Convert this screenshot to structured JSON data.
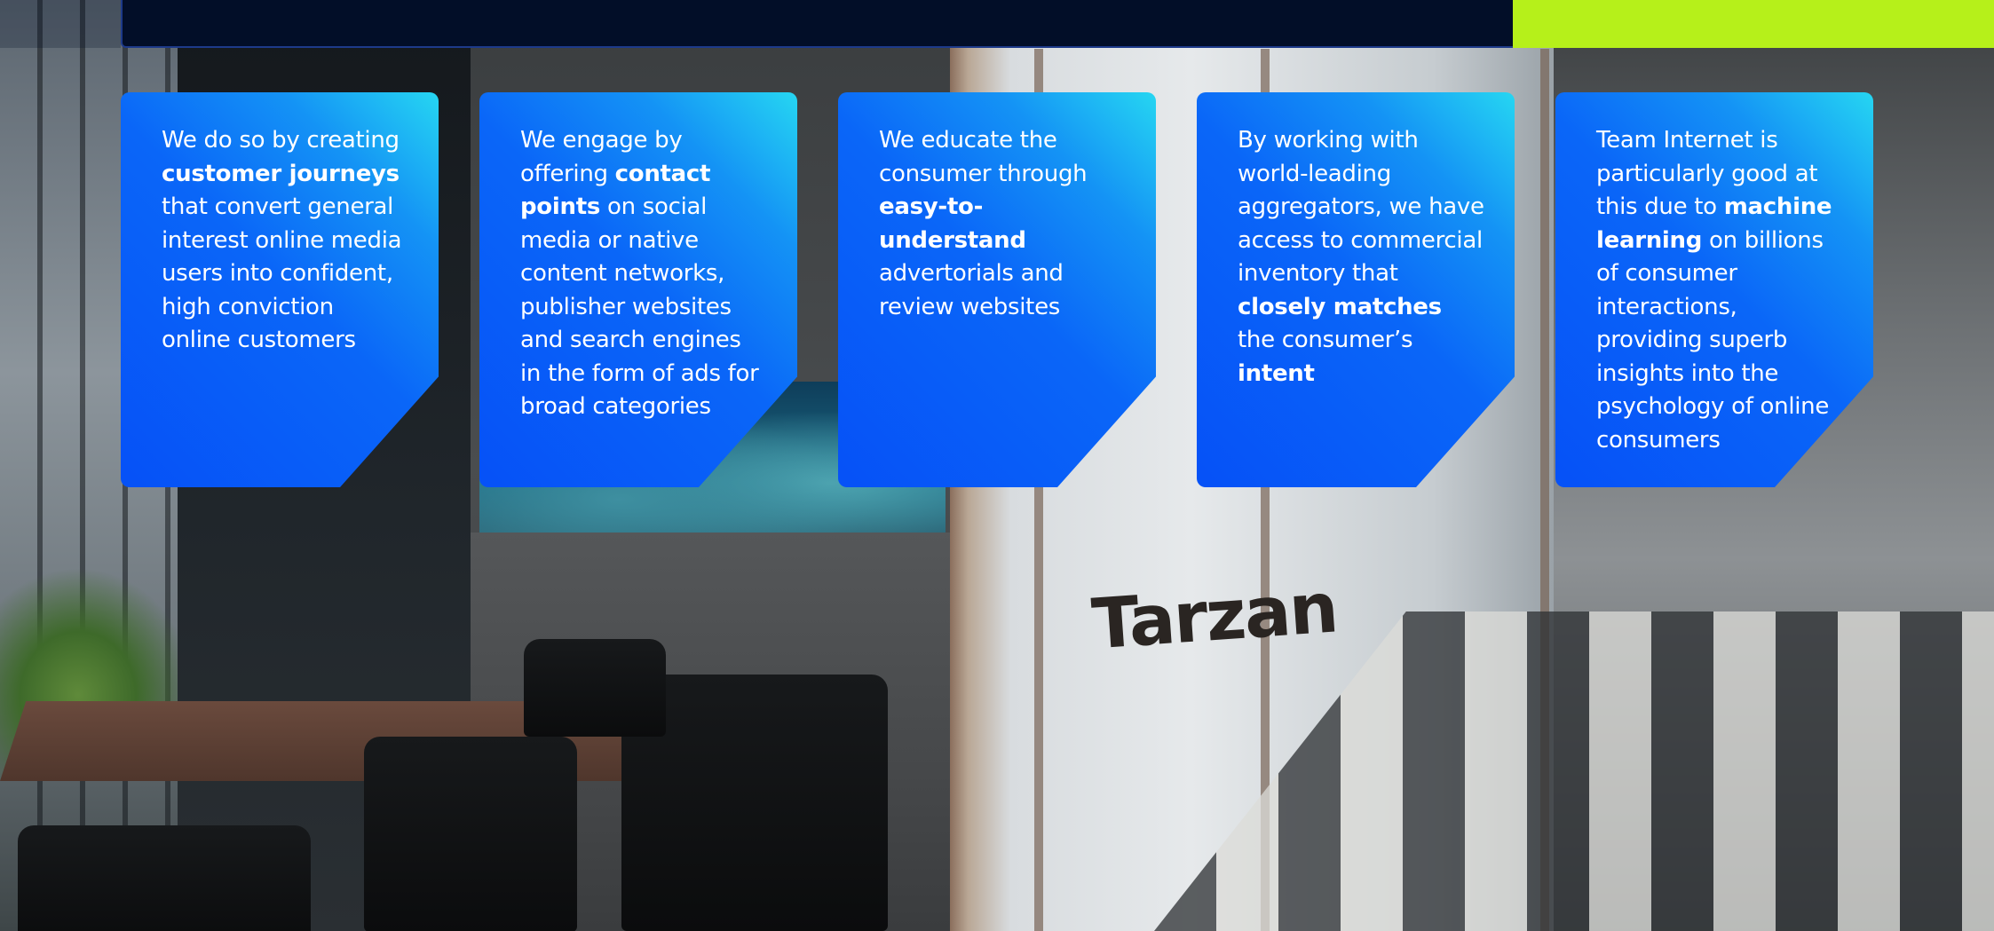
{
  "photo": {
    "door_sign": "Tarzan"
  },
  "cards": [
    {
      "segments": [
        {
          "text": "We do so by creating ",
          "bold": false
        },
        {
          "text": "customer journeys",
          "bold": true
        },
        {
          "text": " that convert general interest online media users into confident, high conviction online customers",
          "bold": false
        }
      ]
    },
    {
      "segments": [
        {
          "text": "We engage by offering ",
          "bold": false
        },
        {
          "text": "contact points",
          "bold": true
        },
        {
          "text": " on social media or native content networks, publisher websites and search engines in the form of ads for broad categories",
          "bold": false
        }
      ]
    },
    {
      "segments": [
        {
          "text": "We educate the consumer through ",
          "bold": false
        },
        {
          "text": "easy-to-understand",
          "bold": true
        },
        {
          "text": " advertorials and review websites",
          "bold": false
        }
      ]
    },
    {
      "segments": [
        {
          "text": "By working with world-leading aggregators, we have access to commercial inventory that ",
          "bold": false
        },
        {
          "text": "closely matches",
          "bold": true
        },
        {
          "text": " the consumer’s ",
          "bold": false
        },
        {
          "text": "intent",
          "bold": true
        }
      ]
    },
    {
      "segments": [
        {
          "text": "Team Internet is particularly good at this due to ",
          "bold": false
        },
        {
          "text": "machine learning",
          "bold": true
        },
        {
          "text": " on billions of consumer interactions, providing superb insights into the psychology of online consumers",
          "bold": false
        }
      ]
    }
  ],
  "colors": {
    "top_bar_dark": "#020e28",
    "top_bar_lime": "#b6f01a",
    "card_gradient_start": "#26d6f2",
    "card_gradient_end": "#0651f7",
    "card_text": "#ffffff"
  }
}
